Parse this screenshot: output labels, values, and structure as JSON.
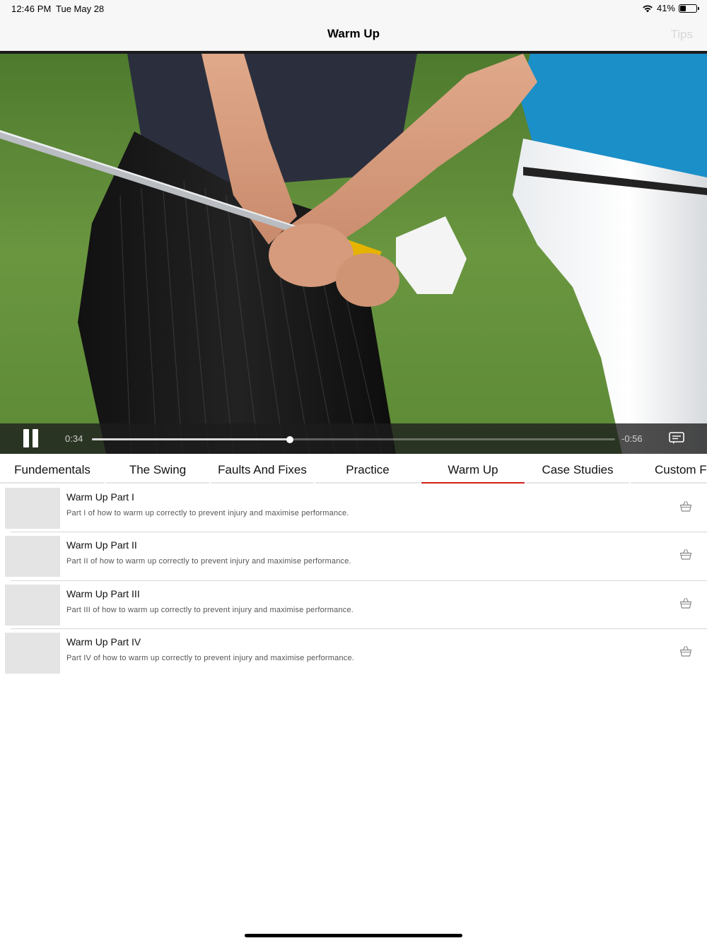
{
  "status_bar": {
    "time": "12:46 PM",
    "date": "Tue May 28",
    "battery_text": "41%",
    "battery_level": 0.41
  },
  "nav": {
    "title": "Warm Up",
    "tips_label": "Tips"
  },
  "player": {
    "elapsed": "0:34",
    "remaining": "-0:56",
    "progress": 0.378,
    "state": "playing",
    "pause_icon": "pause-icon",
    "subtitles_icon": "subtitles-icon"
  },
  "tabs": [
    {
      "label": "Fundementals",
      "active": false
    },
    {
      "label": "The Swing",
      "active": false
    },
    {
      "label": "Faults And Fixes",
      "active": false
    },
    {
      "label": "Practice",
      "active": false
    },
    {
      "label": "Warm Up",
      "active": true
    },
    {
      "label": "Case Studies",
      "active": false
    },
    {
      "label": "Custom Fi",
      "active": false
    }
  ],
  "videos": [
    {
      "title": "Warm Up Part I",
      "description": "Part I of how to warm up correctly to prevent injury and maximise performance.",
      "icon": "basket-icon"
    },
    {
      "title": "Warm Up Part II",
      "description": "Part II of how to warm up correctly to prevent injury and maximise performance.",
      "icon": "basket-icon"
    },
    {
      "title": "Warm Up Part III",
      "description": "Part III of how to warm up correctly to prevent injury and maximise performance.",
      "icon": "basket-icon"
    },
    {
      "title": "Warm Up Part IV",
      "description": "Part IV of how to warm up correctly to prevent injury and maximise performance.",
      "icon": "basket-icon"
    }
  ],
  "colors": {
    "accent": "#d0201a",
    "tips_disabled": "#d8d8d8",
    "thumbnail_placeholder": "#e4e4e4"
  }
}
